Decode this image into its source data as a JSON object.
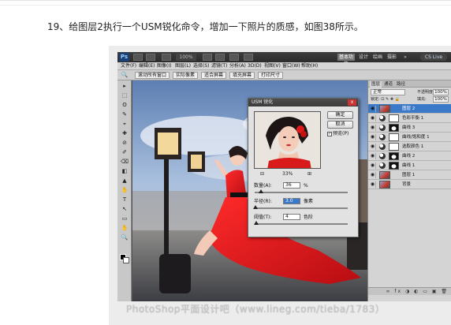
{
  "caption": "19、给图层2执行一个USM锐化命令，增加一下照片的质感，如图38所示。",
  "photoshop": {
    "logo": "Ps",
    "zoom": "100%",
    "workspace_buttons": [
      "基本功能",
      "设计",
      "绘画",
      "摄影"
    ],
    "workspace_active_index": 0,
    "cs_live": "CS Live",
    "menus": [
      "文件(F)",
      "编辑(E)",
      "图像(I)",
      "图层(L)",
      "选择(S)",
      "滤镜(T)",
      "分析(A)",
      "3D(D)",
      "视图(V)",
      "窗口(W)",
      "帮助(H)"
    ],
    "options_buttons": [
      "滚动所有窗口",
      "实际像素",
      "适合屏幕",
      "填充屏幕",
      "打印尺寸"
    ],
    "tool_glyphs": [
      "▸",
      "⬚",
      "ʘ",
      "✎",
      "⌖",
      "✚",
      "⊘",
      "✐",
      "⌫",
      "◧",
      "▲",
      "✋",
      "T",
      "↖",
      "▭",
      "✋",
      "🔍"
    ]
  },
  "dialog": {
    "title": "USM 锐化",
    "close": "x",
    "ok": "确定",
    "cancel": "取消",
    "preview_label": "预览(P)",
    "preview_checked": true,
    "zoom_minus": "⊟",
    "zoom_value": "33%",
    "zoom_plus": "⊞",
    "amount_label": "数量(A):",
    "amount_value": "36",
    "amount_unit": "%",
    "amount_fraction": 0.07,
    "radius_label": "半径(R):",
    "radius_value": "3.0",
    "radius_unit": "像素",
    "radius_fraction": 0.01,
    "threshold_label": "阈值(T):",
    "threshold_value": "4",
    "threshold_unit": "色阶",
    "threshold_fraction": 0.02
  },
  "layers_panel": {
    "tabs": [
      "图层",
      "通道",
      "路径"
    ],
    "active_tab_index": 0,
    "blend_mode": "正常",
    "opacity_label": "不透明度:",
    "opacity": "100%",
    "lock_label": "锁定: ⊡ ✎ ✚ 🔒",
    "fill_label": "填充:",
    "fill": "100%",
    "layers": [
      {
        "name": "图层 2",
        "kind": "photo",
        "selected": true
      },
      {
        "name": "色彩平衡 1",
        "kind": "adjustment",
        "selected": false
      },
      {
        "name": "曲线 3",
        "kind": "adjustment-dark",
        "selected": false
      },
      {
        "name": "曲线/饱和度 1",
        "kind": "adjustment",
        "selected": false
      },
      {
        "name": "选取颜色 1",
        "kind": "adjustment",
        "selected": false
      },
      {
        "name": "曲线 2",
        "kind": "adjustment-dark",
        "selected": false
      },
      {
        "name": "曲线 1",
        "kind": "adjustment-dark",
        "selected": false
      },
      {
        "name": "图层 1",
        "kind": "photo",
        "selected": false
      },
      {
        "name": "背景",
        "kind": "photo",
        "selected": false
      }
    ],
    "bottom_icons": "∞ fx ◑ ◐ ▭ ▣ 🗑"
  },
  "watermark": "PhotoShop平面设计吧（www.lineg.com/tieba/1783）"
}
